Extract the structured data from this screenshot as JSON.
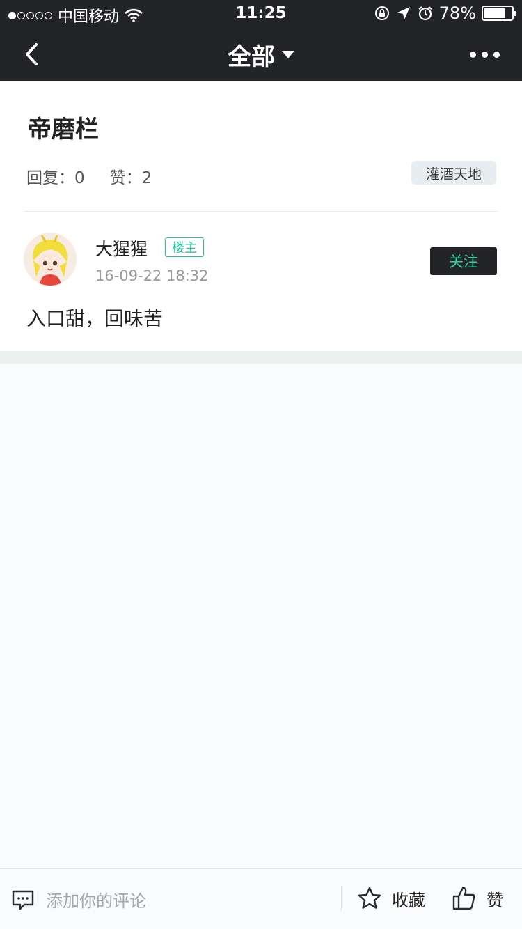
{
  "status_bar": {
    "carrier": "中国移动",
    "time": "11:25",
    "battery_text": "78%",
    "battery_level": 0.78
  },
  "nav": {
    "title": "全部"
  },
  "post": {
    "title": "帝磨栏",
    "reply_label": "回复：0",
    "like_label": "赞：2",
    "category": "灌酒天地",
    "author": {
      "name": "大猩猩",
      "badge": "楼主",
      "time": "16-09-22 18:32"
    },
    "follow_label": "关注",
    "body": "入口甜，回味苦"
  },
  "bottom_bar": {
    "comment_placeholder": "添加你的评论",
    "favorite_label": "收藏",
    "like_label": "赞"
  },
  "colors": {
    "nav_bg": "#222428",
    "accent_green": "#22c3a0",
    "follow_text": "#34d39c"
  }
}
